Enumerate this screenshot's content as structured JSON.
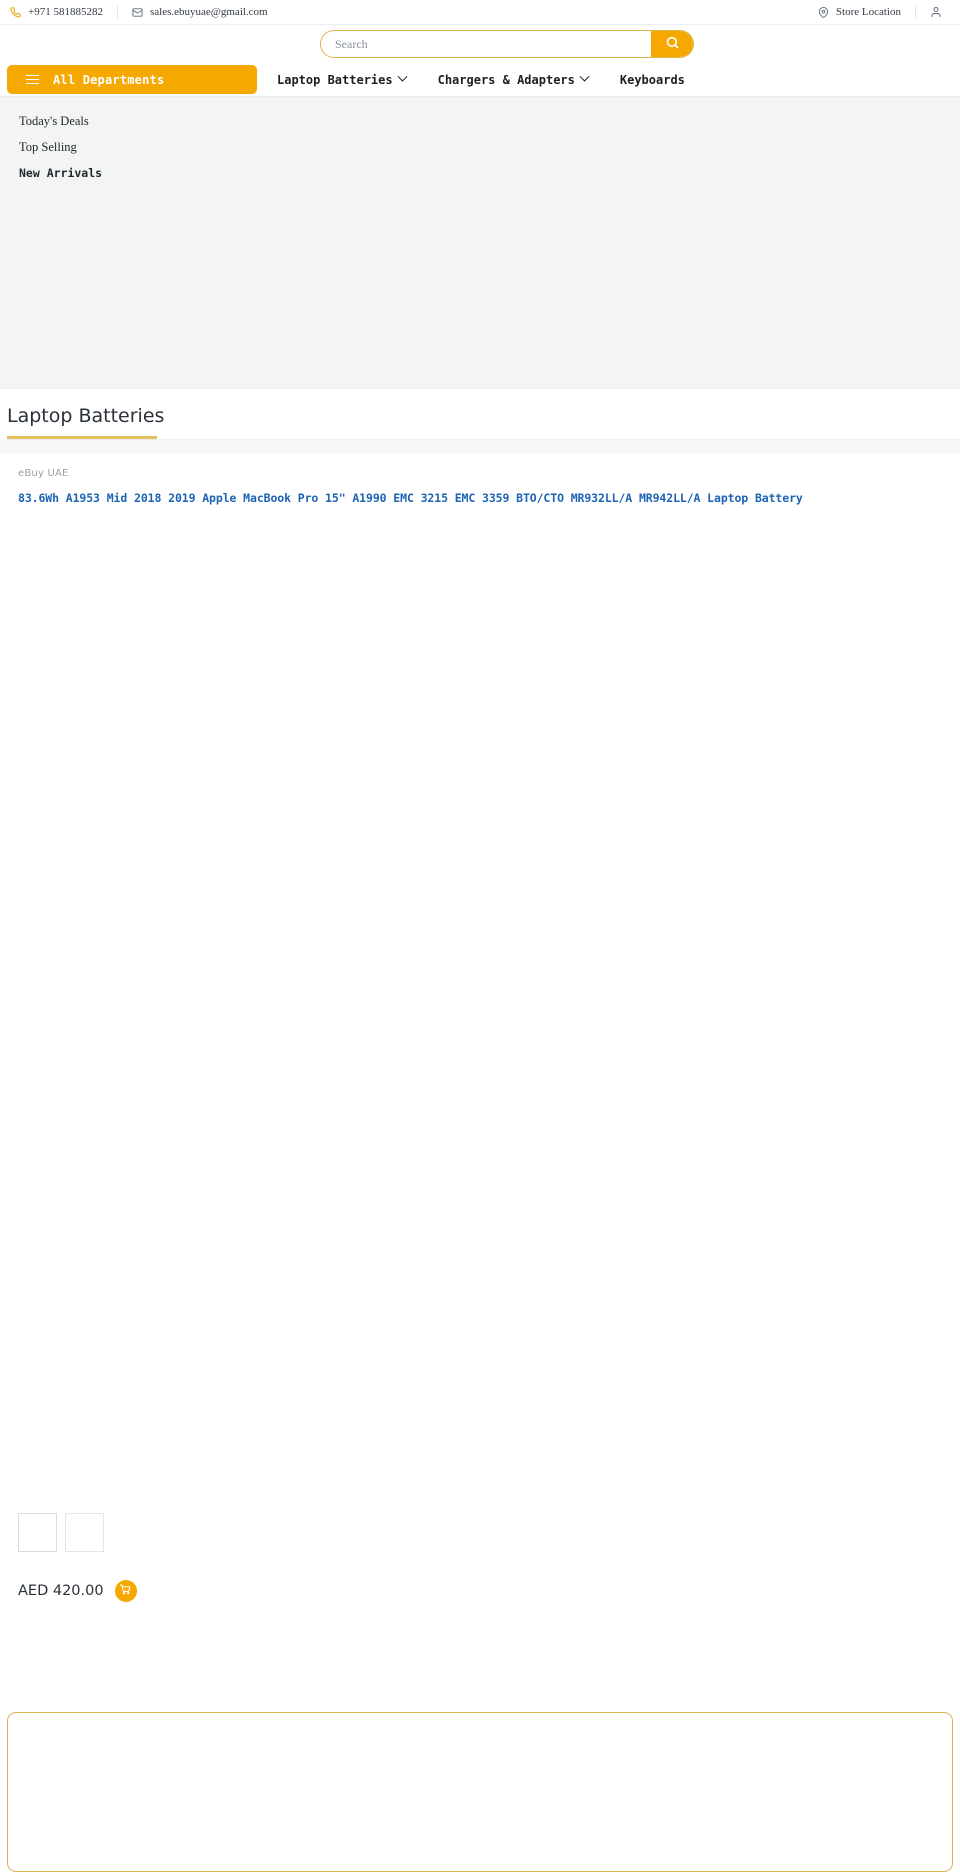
{
  "topbar": {
    "phone": "+971 581885282",
    "email": "sales.ebuyuae@gmail.com",
    "store_location": "Store Location",
    "phone_icon": "phone-icon",
    "email_icon": "envelope-icon",
    "location_icon": "map-pin-icon",
    "account_icon": "user-account-icon"
  },
  "search": {
    "placeholder": "Search",
    "value": "",
    "button_icon": "search-icon",
    "accent_color": "#f5a800",
    "border_color": "#dcb551"
  },
  "nav": {
    "all_departments": "All Departments",
    "menu_icon": "hamburger-menu-icon",
    "items": [
      {
        "label": "Laptop Batteries",
        "has_dropdown": true
      },
      {
        "label": "Chargers & Adapters",
        "has_dropdown": true
      },
      {
        "label": "Keyboards",
        "has_dropdown": false
      }
    ]
  },
  "sidebar": {
    "items": [
      {
        "label": "Today's Deals",
        "style": "serif"
      },
      {
        "label": "Top Selling",
        "style": "serif"
      },
      {
        "label": "New Arrivals",
        "style": "mono-bold"
      }
    ]
  },
  "category": {
    "title": "Laptop Batteries",
    "accent_color": "#e3c15f"
  },
  "product": {
    "brand": "eBuy UAE",
    "title": "83.6Wh A1953 Mid 2018 2019 Apple MacBook Pro 15\" A1990 EMC 3215 EMC 3359 BTO/CTO MR932LL/A MR942LL/A Laptop Battery",
    "price": "AED 420.00",
    "cart_icon": "shopping-cart-icon",
    "thumbnails": [
      {
        "name": "thumbnail-1",
        "selected": true
      },
      {
        "name": "thumbnail-2",
        "selected": false
      }
    ]
  }
}
